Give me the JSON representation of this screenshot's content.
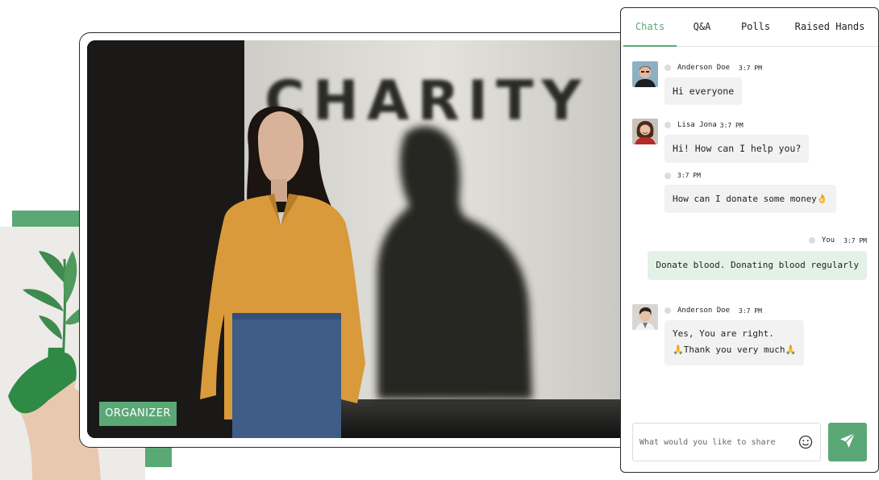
{
  "video": {
    "badge_label": "ORGANIZER",
    "sign_text": "CHARITY"
  },
  "chat": {
    "tabs": [
      {
        "label": "Chats",
        "active": true
      },
      {
        "label": "Q&A",
        "active": false
      },
      {
        "label": "Polls",
        "active": false
      },
      {
        "label": "Raised Hands",
        "active": false
      }
    ],
    "messages": [
      {
        "sender": "Anderson Doe",
        "time": "3:7 PM",
        "lines": [
          "Hi everyone"
        ]
      },
      {
        "sender": "Lisa Jona",
        "time": "3:7 PM",
        "lines": [
          "Hi! How can I help you?"
        ]
      },
      {
        "sender": "",
        "time": "3:7 PM",
        "lines": [
          "How can I donate some money👌"
        ]
      },
      {
        "sender": "You",
        "time": "3:7 PM",
        "lines": [
          "Donate blood. Donating blood regularly"
        ]
      },
      {
        "sender": "Anderson Doe",
        "time": "3:7 PM",
        "lines": [
          "Yes, You are right.",
          "🙏Thank you very much🙏"
        ]
      }
    ],
    "composer": {
      "placeholder": "What would you like to share"
    }
  },
  "colors": {
    "accent": "#5aa876",
    "own_bubble": "#e3f1e7",
    "other_bubble": "#f2f2f2"
  },
  "icons": [
    "smiley-icon",
    "send-icon"
  ]
}
